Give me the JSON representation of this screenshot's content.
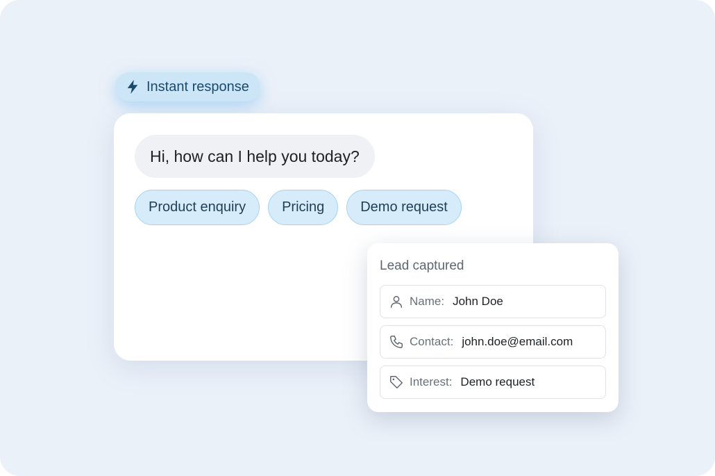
{
  "badge": {
    "icon": "lightning-bolt-icon",
    "label": "Instant response"
  },
  "chat": {
    "greeting": "Hi, how can I help you today?",
    "options": [
      "Product enquiry",
      "Pricing",
      "Demo request"
    ]
  },
  "lead": {
    "title": "Lead captured",
    "fields": [
      {
        "icon": "user-icon",
        "label": "Name:",
        "value": "John Doe"
      },
      {
        "icon": "phone-icon",
        "label": "Contact:",
        "value": "john.doe@email.com"
      },
      {
        "icon": "tag-icon",
        "label": "Interest:",
        "value": "Demo request"
      }
    ]
  },
  "colors": {
    "background": "#ebf1f9",
    "chip_fill": "#d7ecfa",
    "chip_border": "#a6d2ee",
    "badge_fill": "#cde6f7",
    "accent_dark": "#1a4a6e"
  }
}
